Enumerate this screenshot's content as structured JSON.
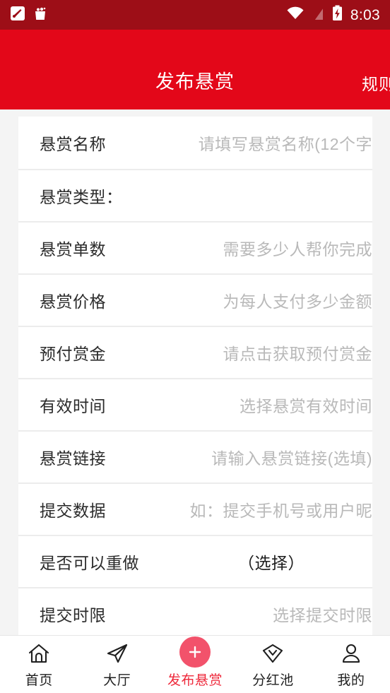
{
  "statusbar": {
    "time": "8:03",
    "left_icons": [
      "app-notification-icon",
      "shopping-bag-icon"
    ],
    "right_icons": [
      "wifi-icon",
      "no-signal-icon",
      "battery-charging-icon"
    ],
    "background_color": "#9d0e17"
  },
  "header": {
    "title": "发布悬赏",
    "action_label": "规则",
    "background_color": "#e30719"
  },
  "form": {
    "rows": [
      {
        "label": "悬赏名称",
        "value": "请填写悬赏名称(12个字",
        "style": "placeholder"
      },
      {
        "label": "悬赏类型：",
        "value": "",
        "style": "none"
      },
      {
        "label": "悬赏单数",
        "value": "需要多少人帮你完成",
        "style": "placeholder"
      },
      {
        "label": "悬赏价格",
        "value": "为每人支付多少金额",
        "style": "placeholder"
      },
      {
        "label": "预付赏金",
        "value": "请点击获取预付赏金",
        "style": "placeholder"
      },
      {
        "label": "有效时间",
        "value": "选择悬赏有效时间",
        "style": "placeholder"
      },
      {
        "label": "悬赏链接",
        "value": "请输入悬赏链接(选填)",
        "style": "placeholder"
      },
      {
        "label": "提交数据",
        "value": "如：提交手机号或用户昵",
        "style": "placeholder"
      },
      {
        "label": "是否可以重做",
        "value": "（选择）",
        "style": "dark"
      },
      {
        "label": "提交时限",
        "value": "选择提交时限",
        "style": "placeholder"
      }
    ]
  },
  "tabbar": {
    "items": [
      {
        "label": "首页",
        "icon": "home-icon",
        "active": false
      },
      {
        "label": "大厅",
        "icon": "paper-plane-icon",
        "active": false
      },
      {
        "label": "发布悬赏",
        "icon": "plus-circle-icon",
        "active": true
      },
      {
        "label": "分红池",
        "icon": "diamond-icon",
        "active": false
      },
      {
        "label": "我的",
        "icon": "person-icon",
        "active": false
      }
    ],
    "active_color": "#ee2a3c",
    "fab_color": "#f2526b"
  }
}
